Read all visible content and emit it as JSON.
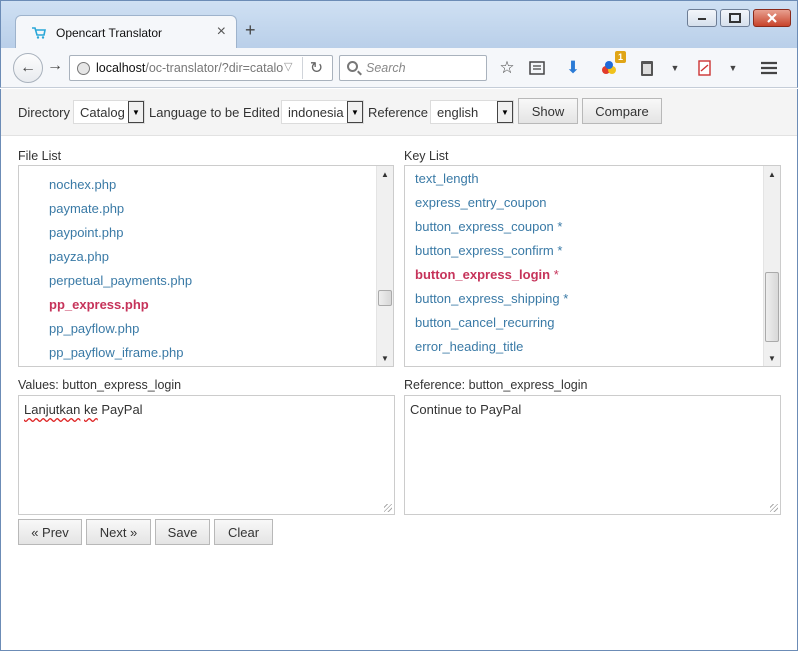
{
  "browser": {
    "tab_title": "Opencart Translator",
    "url_host": "localhost",
    "url_rest": "/oc-translator/?dir=catalo",
    "search_placeholder": "Search",
    "addon_badge": "1"
  },
  "controls": {
    "directory_label": "Directory",
    "directory_value": "Catalog",
    "language_label": "Language to be Edited",
    "language_value": "indonesia",
    "reference_label": "Reference",
    "reference_value": "english",
    "show_label": "Show",
    "compare_label": "Compare"
  },
  "file_list": {
    "label": "File List",
    "items": [
      "nochex.php",
      "paymate.php",
      "paypoint.php",
      "payza.php",
      "perpetual_payments.php",
      "pp_express.php",
      "pp_payflow.php",
      "pp_payflow_iframe.php"
    ],
    "active": "pp_express.php"
  },
  "key_list": {
    "label": "Key List",
    "items": [
      {
        "key": "text_length",
        "star": ""
      },
      {
        "key": "express_entry_coupon",
        "star": ""
      },
      {
        "key": "button_express_coupon",
        "star": "*"
      },
      {
        "key": "button_express_confirm",
        "star": "*"
      },
      {
        "key": "button_express_login",
        "star": "*"
      },
      {
        "key": "button_express_shipping",
        "star": "*"
      },
      {
        "key": "button_cancel_recurring",
        "star": ""
      },
      {
        "key": "error_heading_title",
        "star": ""
      }
    ],
    "active": "button_express_login"
  },
  "values": {
    "label": "Values: button_express_login",
    "text_word1": "Lanjutkan",
    "text_word2": "ke",
    "text_word3": "PayPal"
  },
  "reference": {
    "label": "Reference: button_express_login",
    "text": "Continue to PayPal"
  },
  "actions": {
    "prev_label": "« Prev",
    "next_label": "Next »",
    "save_label": "Save",
    "clear_label": "Clear"
  }
}
